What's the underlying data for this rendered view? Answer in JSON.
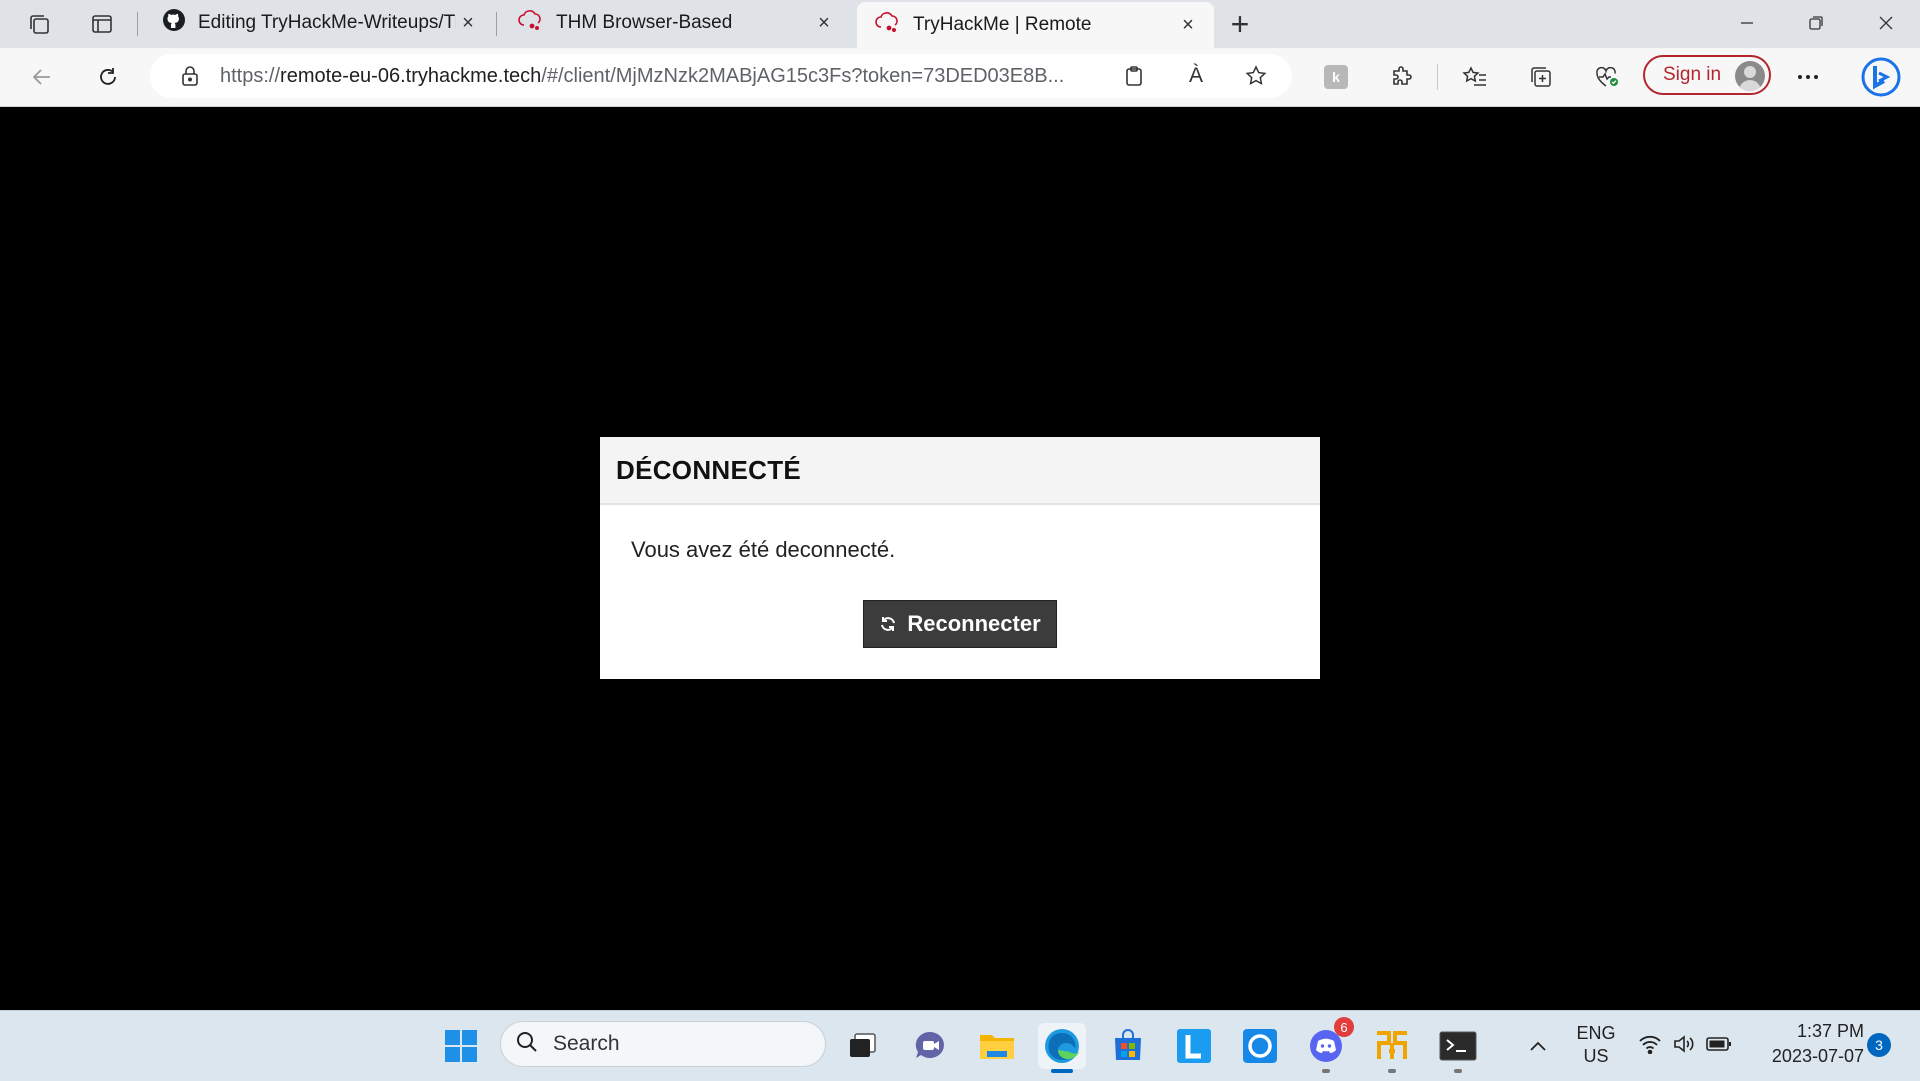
{
  "browser": {
    "tabs": [
      {
        "title": "Editing TryHackMe-Writeups/TryHackMe",
        "close": "×"
      },
      {
        "title": "THM Browser-Based",
        "close": "×"
      },
      {
        "title": "TryHackMe | Remote",
        "close": "×"
      }
    ],
    "new_tab": "+",
    "url_prefix": "https://",
    "url_host": "remote-eu-06.tryhackme.tech",
    "url_rest": "/#/client/MjMzNzk2MABjAG15c3Fs?token=73DED03E8B...",
    "read_aloud": "À",
    "sign_in": "Sign in"
  },
  "dialog": {
    "title": "DÉCONNECTÉ",
    "message": "Vous avez été deconnecté.",
    "button": "Reconnecter"
  },
  "taskbar": {
    "search_placeholder": "Search",
    "discord_badge": "6",
    "lang_top": "ENG",
    "lang_bottom": "US",
    "time": "1:37 PM",
    "date": "2023-07-07",
    "notifications": "3"
  }
}
